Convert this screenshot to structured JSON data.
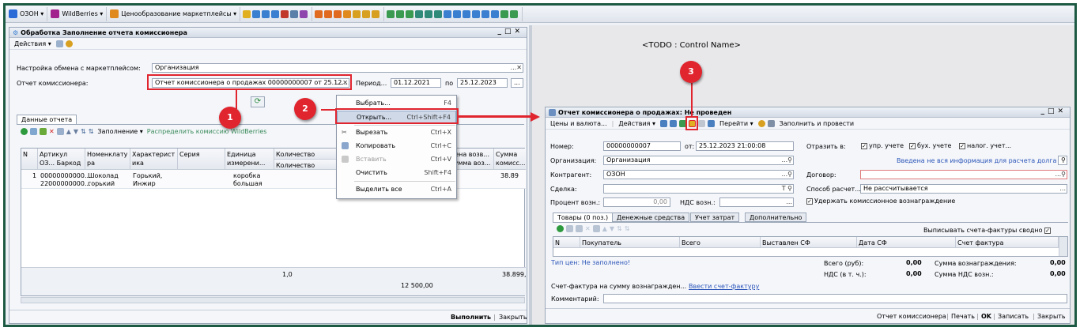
{
  "topbar": {
    "items": [
      {
        "label": "ОЗОН",
        "color": "#2a6bd8"
      },
      {
        "label": "WildBerries",
        "color": "#a3238e"
      },
      {
        "label": "Ценообразование маркетплейсы",
        "color": "#e08a1e"
      }
    ]
  },
  "left": {
    "title": "Обработка  Заполнение отчета комиссионера",
    "actions": "Действия",
    "settings_label": "Настройка обмена с маркетплейсом:",
    "settings_value": "Организация",
    "report_label": "Отчет комиссионера:",
    "report_value": "Отчет комиссионера о продажах 00000000007 от 25.12....",
    "period_label": "Период...",
    "date_from": "01.12.2021",
    "po": "по",
    "date_to": "25.12.2023",
    "tab_label": "Данные отчета",
    "fill_label": "Заполнение",
    "distribute_label": "Распределить комиссию WildBerries",
    "columns": [
      "N",
      "Артикул ОЗ... Баркод",
      "Номенклату ра",
      "Характерист ика",
      "Серия",
      "Единица измерени...",
      "Количество",
      "Количество возвр...",
      "Цена возв... Сумма воз...",
      "Сумма комисс..."
    ],
    "row": {
      "n": "1",
      "article": "00000000000...",
      "barcode": "22000000000...",
      "nomenclature": "Шоколад горький",
      "characteristic": "Горький, Инжир",
      "unit": "коробка большая",
      "commission": "38.89"
    },
    "totals": {
      "qty": "1,0",
      "sum": "12 500,00",
      "commission": "38.899,"
    },
    "execute": "Выполнить",
    "close": "Закрыть"
  },
  "menu": {
    "items": [
      {
        "label": "Выбрать...",
        "shortcut": "F4"
      },
      {
        "label": "Открыть...",
        "shortcut": "Ctrl+Shift+F4"
      },
      {
        "label": "Вырезать",
        "shortcut": "Ctrl+X"
      },
      {
        "label": "Копировать",
        "shortcut": "Ctrl+C"
      },
      {
        "label": "Вставить",
        "shortcut": "Ctrl+V"
      },
      {
        "label": "Очистить",
        "shortcut": "Shift+F4"
      },
      {
        "label": "Выделить все",
        "shortcut": "Ctrl+A"
      }
    ]
  },
  "badges": {
    "b1": "1",
    "b2": "2",
    "b3": "3"
  },
  "todo_label": "<TODO : Control Name>",
  "right": {
    "title": "Отчет комиссионера о продажах: Не проведен",
    "toolbar": {
      "prices": "Цены и валюта...",
      "actions": "Действия",
      "goto": "Перейти",
      "fill_post": "Заполнить и провести"
    },
    "number_label": "Номер:",
    "number_value": "00000000007",
    "from_label": "от:",
    "date_value": "25.12.2023 21:00:08",
    "reflect_label": "Отразить в:",
    "reflect": [
      "упр. учете",
      "бух. учете",
      "налог. учет..."
    ],
    "org_label": "Организация:",
    "org_value": "Организация",
    "warning_link": "Введена не вся информация для расчета долга",
    "contractor_label": "Контрагент:",
    "contractor_value": "ОЗОН",
    "contract_label": "Договор:",
    "deal_label": "Сделка:",
    "calc_method_label": "Способ расчет...",
    "calc_method_value": "Не рассчитывается",
    "percent_label": "Процент возн.:",
    "percent_value": "0,00",
    "vat_label": "НДС возн.:",
    "retain_label": "Удержать комиссионное вознаграждение",
    "tabs": [
      "Товары (0 поз.)",
      "Денежные средства",
      "Учет затрат",
      "Дополнительно"
    ],
    "invoice_summary_label": "Выписывать счета-фактуры сводно",
    "columns": [
      "N",
      "Покупатель",
      "Всего",
      "Выставлен СФ",
      "Дата СФ",
      "Счет фактура"
    ],
    "price_type": "Тип цен: Не заполнено!",
    "total_label": "Всего (руб):",
    "total_value": "0,00",
    "vat_in_label": "НДС (в т. ч.):",
    "vat_in_value": "0,00",
    "reward_sum_label": "Сумма вознаграждения:",
    "reward_sum_value": "0,00",
    "reward_vat_label": "Сумма НДС возн.:",
    "reward_vat_value": "0,00",
    "invoice_label": "Счет-фактура на сумму вознагражден...",
    "invoice_link": "Ввести счет-фактуру",
    "comment_label": "Комментарий:",
    "bottom": [
      "Отчет комиссионера",
      "Печать",
      "OK",
      "Записать",
      "Закрыть"
    ]
  }
}
